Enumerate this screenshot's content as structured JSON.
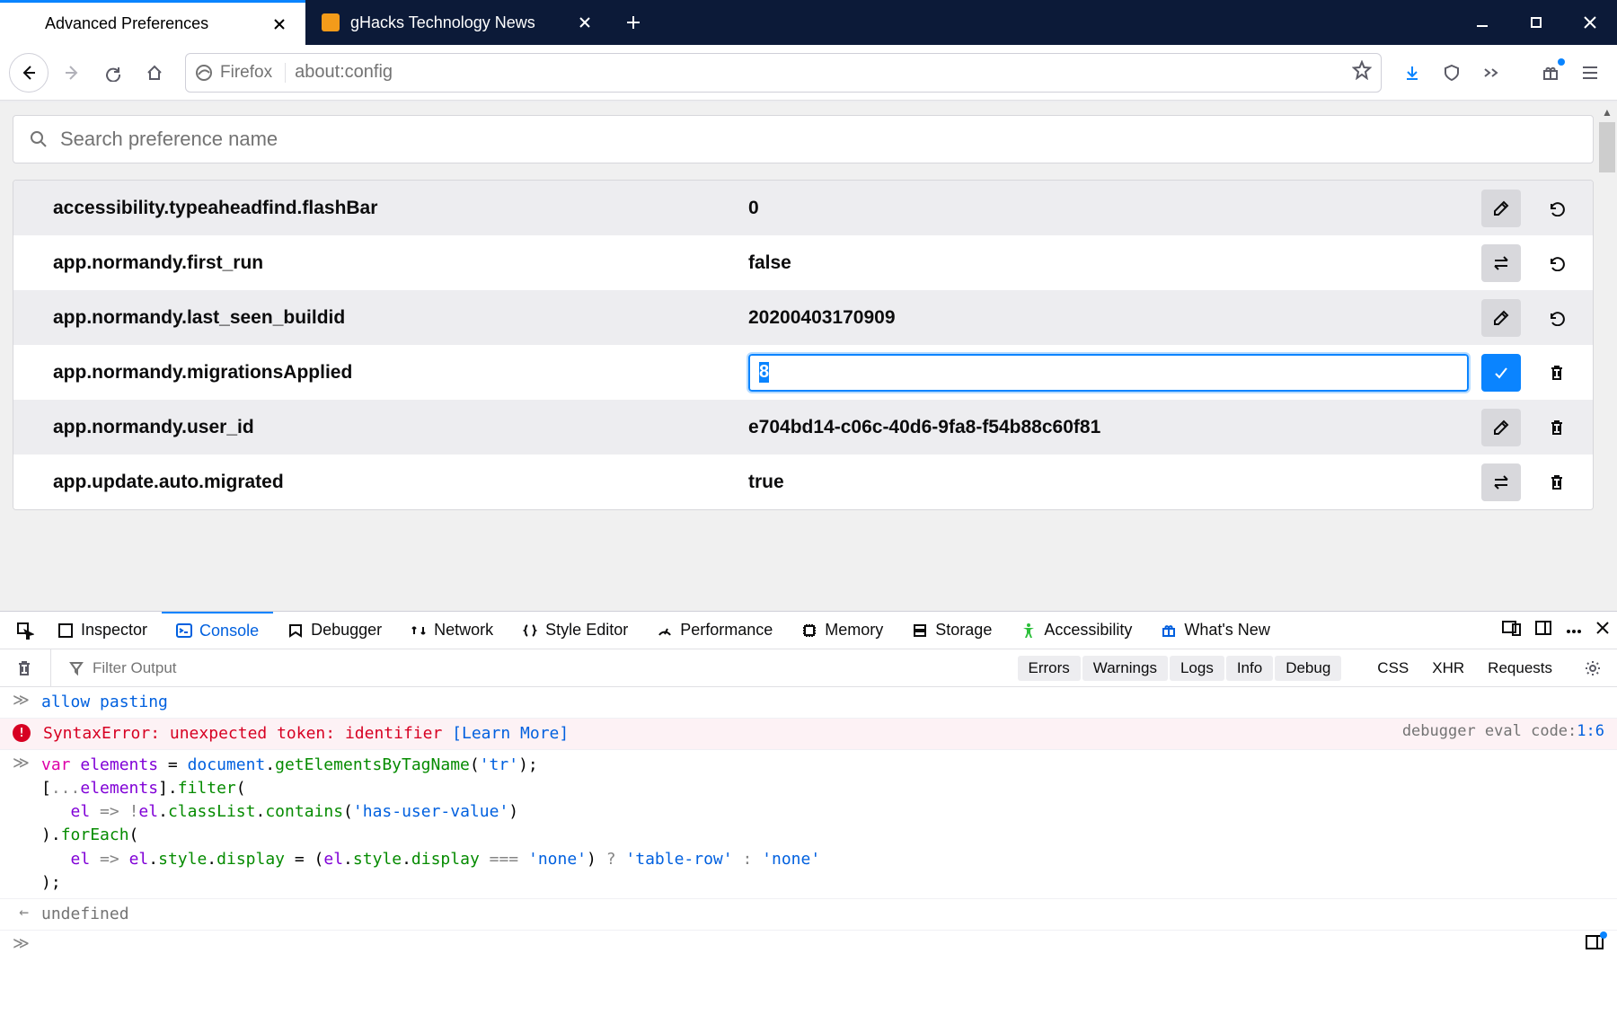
{
  "tabs": {
    "active_title": "Advanced Preferences",
    "inactive_title": "gHacks Technology News"
  },
  "url": {
    "identity": "Firefox",
    "address": "about:config"
  },
  "search": {
    "placeholder": "Search preference name"
  },
  "prefs": [
    {
      "name": "accessibility.typeaheadfind.flashBar",
      "value": "0",
      "edit": "pencil",
      "second": "reset"
    },
    {
      "name": "app.normandy.first_run",
      "value": "false",
      "edit": "toggle",
      "second": "reset"
    },
    {
      "name": "app.normandy.last_seen_buildid",
      "value": "20200403170909",
      "edit": "pencil",
      "second": "reset"
    },
    {
      "name": "app.normandy.migrationsApplied",
      "value": "8",
      "edit": "save",
      "second": "trash",
      "editing": true
    },
    {
      "name": "app.normandy.user_id",
      "value": "e704bd14-c06c-40d6-9fa8-f54b88c60f81",
      "edit": "pencil",
      "second": "trash"
    },
    {
      "name": "app.update.auto.migrated",
      "value": "true",
      "edit": "toggle",
      "second": "trash"
    }
  ],
  "devtools": {
    "tabs": [
      "Inspector",
      "Console",
      "Debugger",
      "Network",
      "Style Editor",
      "Performance",
      "Memory",
      "Storage",
      "Accessibility",
      "What's New"
    ],
    "filter_placeholder": "Filter Output",
    "chips_bg": [
      "Errors",
      "Warnings",
      "Logs",
      "Info",
      "Debug"
    ],
    "chips_plain": [
      "CSS",
      "XHR",
      "Requests"
    ],
    "lines": {
      "allow": "allow pasting",
      "err_text": "SyntaxError: unexpected token: identifier",
      "err_learn": "[Learn More]",
      "err_rhs_a": "debugger eval code:",
      "err_rhs_b": "1:6",
      "out": "undefined",
      "code": "var elements = document.getElementsByTagName('tr');\n[...elements].filter(\n   el => !el.classList.contains('has-user-value')\n).forEach(\n   el => el.style.display = (el.style.display === 'none') ? 'table-row' : 'none'\n);"
    }
  }
}
